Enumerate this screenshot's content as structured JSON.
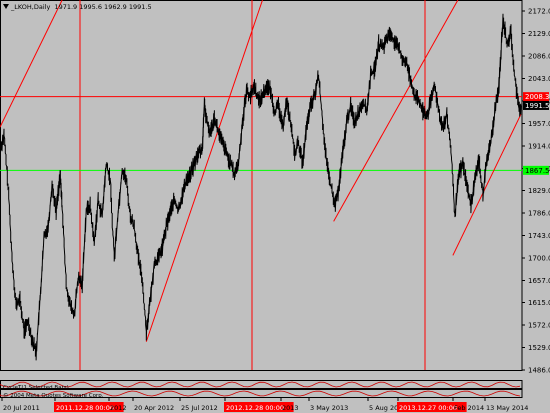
{
  "header": {
    "symbol": "_LKOH,Daily",
    "ohlc": "1971.9 1995.6 1962.9 1991.5"
  },
  "indicator_panels": [
    {
      "label": "CycleT(1,Selected Bars)"
    },
    {
      "label": "© 2004 Meta Quotes Software Corp."
    }
  ],
  "colors": {
    "background": "#c0c0c0",
    "price": "#000000",
    "trend_lines": "#ff0000",
    "vertical_lines": "#ff0000",
    "level_red": "#ff0000",
    "level_green": "#00ff00",
    "tag_red": "#ff0000",
    "tag_black": "#000000",
    "tag_green": "#00ff00"
  },
  "chart_data": {
    "type": "line",
    "title": "",
    "instrument": "_LKOH",
    "timeframe": "Daily",
    "ylim": [
      1486,
      2193
    ],
    "y_ticks": [
      "2172.0",
      "2129.0",
      "2086.0",
      "2043.0",
      "2000.0",
      "1957.0",
      "1914.0",
      "1871.0",
      "1829.0",
      "1786.0",
      "1743.0",
      "1700.0",
      "1657.0",
      "1615.0",
      "1572.0",
      "1529.0",
      "1486.0"
    ],
    "x_ticks": [
      "20 Jul 2011",
      "2011.12.28 00:00",
      "2012",
      "20 Apr 2012",
      "25 Jul 2012",
      "2012.12.28 00:00",
      "2013",
      "3 May 2013",
      "5 Aug 2013",
      "2013.12.27 00:00",
      "Feb 2014",
      "13 May 2014"
    ],
    "x_ticks_highlighted": [
      "2011.12.28 00:00",
      "2012.12.28 00:00",
      "2013.12.27 00:00"
    ],
    "vertical_lines": [
      "2011.12.28 00:00",
      "2012.12.28 00:00",
      "2013.12.27 00:00"
    ],
    "horizontal_levels": [
      {
        "value": 2008.3,
        "color": "red",
        "label": "2008.3"
      },
      {
        "value": 1867.5,
        "color": "green",
        "label": "1867.5"
      }
    ],
    "last_price": {
      "value": 1991.5,
      "label": "1991.5"
    },
    "trend_lines": [
      {
        "from": {
          "x": 0,
          "y": 1950
        },
        "to": {
          "x": 62,
          "y": 2193
        }
      },
      {
        "from": {
          "x": 146,
          "y": 1540
        },
        "to": {
          "x": 262,
          "y": 2193
        }
      },
      {
        "from": {
          "x": 333,
          "y": 1770
        },
        "to": {
          "x": 457,
          "y": 2193
        }
      },
      {
        "from": {
          "x": 452,
          "y": 1705
        },
        "to": {
          "x": 520,
          "y": 1975
        }
      }
    ],
    "x_index_range": [
      0,
      520
    ],
    "series": [
      {
        "values": [
          [
            0,
            1905
          ],
          [
            4,
            1935
          ],
          [
            8,
            1840
          ],
          [
            12,
            1700
          ],
          [
            16,
            1610
          ],
          [
            20,
            1620
          ],
          [
            24,
            1560
          ],
          [
            28,
            1580
          ],
          [
            32,
            1545
          ],
          [
            36,
            1520
          ],
          [
            40,
            1620
          ],
          [
            44,
            1740
          ],
          [
            48,
            1760
          ],
          [
            52,
            1840
          ],
          [
            56,
            1790
          ],
          [
            60,
            1860
          ],
          [
            62,
            1800
          ],
          [
            66,
            1650
          ],
          [
            70,
            1610
          ],
          [
            74,
            1590
          ],
          [
            78,
            1660
          ],
          [
            82,
            1650
          ],
          [
            86,
            1790
          ],
          [
            90,
            1800
          ],
          [
            94,
            1730
          ],
          [
            98,
            1810
          ],
          [
            102,
            1780
          ],
          [
            106,
            1880
          ],
          [
            110,
            1850
          ],
          [
            114,
            1700
          ],
          [
            118,
            1790
          ],
          [
            122,
            1870
          ],
          [
            126,
            1850
          ],
          [
            130,
            1780
          ],
          [
            134,
            1760
          ],
          [
            138,
            1700
          ],
          [
            142,
            1660
          ],
          [
            146,
            1560
          ],
          [
            150,
            1620
          ],
          [
            154,
            1690
          ],
          [
            158,
            1700
          ],
          [
            162,
            1720
          ],
          [
            166,
            1760
          ],
          [
            170,
            1790
          ],
          [
            174,
            1810
          ],
          [
            178,
            1790
          ],
          [
            182,
            1820
          ],
          [
            186,
            1850
          ],
          [
            190,
            1860
          ],
          [
            194,
            1880
          ],
          [
            198,
            1900
          ],
          [
            202,
            1910
          ],
          [
            204,
            2000
          ],
          [
            206,
            1960
          ],
          [
            210,
            1940
          ],
          [
            214,
            1970
          ],
          [
            218,
            1940
          ],
          [
            222,
            1920
          ],
          [
            226,
            1900
          ],
          [
            230,
            1880
          ],
          [
            234,
            1860
          ],
          [
            238,
            1880
          ],
          [
            242,
            1960
          ],
          [
            246,
            2020
          ],
          [
            250,
            2010
          ],
          [
            254,
            2030
          ],
          [
            258,
            2000
          ],
          [
            262,
            2010
          ],
          [
            266,
            2030
          ],
          [
            270,
            2020
          ],
          [
            274,
            1980
          ],
          [
            278,
            1990
          ],
          [
            282,
            1950
          ],
          [
            286,
            2000
          ],
          [
            290,
            1960
          ],
          [
            294,
            1900
          ],
          [
            298,
            1920
          ],
          [
            302,
            1880
          ],
          [
            306,
            1950
          ],
          [
            310,
            1990
          ],
          [
            314,
            2010
          ],
          [
            318,
            2050
          ],
          [
            322,
            1960
          ],
          [
            326,
            1880
          ],
          [
            330,
            1840
          ],
          [
            334,
            1800
          ],
          [
            338,
            1830
          ],
          [
            342,
            1900
          ],
          [
            346,
            1960
          ],
          [
            350,
            1990
          ],
          [
            354,
            1960
          ],
          [
            358,
            1980
          ],
          [
            362,
            2000
          ],
          [
            366,
            1980
          ],
          [
            370,
            2050
          ],
          [
            374,
            2060
          ],
          [
            378,
            2110
          ],
          [
            382,
            2100
          ],
          [
            386,
            2120
          ],
          [
            390,
            2130
          ],
          [
            394,
            2110
          ],
          [
            398,
            2100
          ],
          [
            402,
            2080
          ],
          [
            406,
            2070
          ],
          [
            410,
            2040
          ],
          [
            414,
            2010
          ],
          [
            418,
            2000
          ],
          [
            422,
            1980
          ],
          [
            426,
            1970
          ],
          [
            430,
            2000
          ],
          [
            434,
            2030
          ],
          [
            438,
            1980
          ],
          [
            442,
            1950
          ],
          [
            446,
            1970
          ],
          [
            450,
            1910
          ],
          [
            454,
            1780
          ],
          [
            458,
            1860
          ],
          [
            462,
            1880
          ],
          [
            466,
            1840
          ],
          [
            470,
            1800
          ],
          [
            474,
            1850
          ],
          [
            478,
            1890
          ],
          [
            482,
            1820
          ],
          [
            486,
            1890
          ],
          [
            490,
            1920
          ],
          [
            494,
            1980
          ],
          [
            498,
            2030
          ],
          [
            502,
            2160
          ],
          [
            506,
            2110
          ],
          [
            510,
            2130
          ],
          [
            514,
            2040
          ],
          [
            518,
            1985
          ],
          [
            520,
            1991.5
          ]
        ]
      }
    ]
  }
}
